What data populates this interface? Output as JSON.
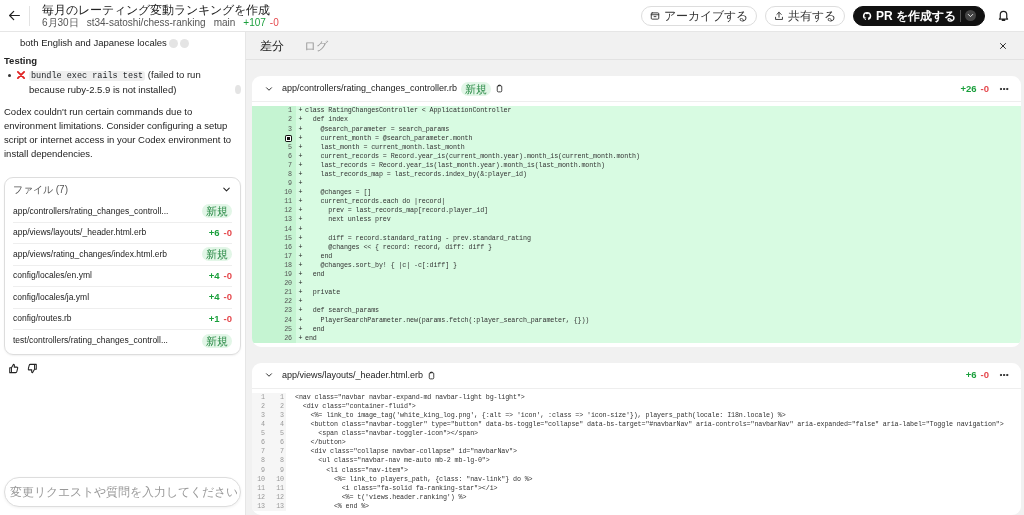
{
  "header": {
    "title": "毎月のレーティング変動ランキングを作成",
    "date": "6月30日",
    "repo": "st34-satoshi/chess-ranking",
    "branch": "main",
    "additions": "+107",
    "deletions": "-0"
  },
  "actions": [
    {
      "kind": "archive",
      "label": "アーカイブする"
    },
    {
      "kind": "share",
      "label": "共有する"
    },
    {
      "kind": "pr",
      "label": "PR を作成する"
    }
  ],
  "sidebar": {
    "summary_tail": "both English and Japanese locales",
    "testing_heading": "Testing",
    "tests": [
      {
        "passed": false,
        "command": "bundle exec rails test",
        "note": "(failed to run because ruby-2.5.9 is not installed)"
      }
    ],
    "note": "Codex couldn't run certain commands due to environment limitations. Consider configuring a setup script or internet access in your Codex environment to install dependencies.",
    "files": {
      "title": "ファイル (7)",
      "expanded": true,
      "items": [
        {
          "name": "app/controllers/rating_changes_controll...",
          "kind": "new",
          "badge": "新規"
        },
        {
          "name": "app/views/layouts/_header.html.erb",
          "kind": "diff",
          "additions": "+6",
          "deletions": "-0"
        },
        {
          "name": "app/views/rating_changes/index.html.erb",
          "kind": "new",
          "badge": "新規"
        },
        {
          "name": "config/locales/en.yml",
          "kind": "diff",
          "additions": "+4",
          "deletions": "-0"
        },
        {
          "name": "config/locales/ja.yml",
          "kind": "diff",
          "additions": "+4",
          "deletions": "-0"
        },
        {
          "name": "config/routes.rb",
          "kind": "diff",
          "additions": "+1",
          "deletions": "-0"
        },
        {
          "name": "test/controllers/rating_changes_controll...",
          "kind": "new",
          "badge": "新規"
        }
      ]
    },
    "input": {
      "placeholder": "変更リクエストや質問を入力してください"
    }
  },
  "tabs": [
    {
      "label": "差分",
      "selected": true
    },
    {
      "label": "ログ",
      "selected": false
    }
  ],
  "diffs": [
    {
      "path": "app/controllers/rating_changes_controller.rb",
      "badge": "新規",
      "expanded": true,
      "additions": "+26",
      "deletions": "-0",
      "lines": [
        {
          "kind": "added",
          "new": "1",
          "sign": "+",
          "text": "class RatingChangesController < ApplicationController"
        },
        {
          "kind": "added",
          "new": "2",
          "sign": "+",
          "text": "  def index"
        },
        {
          "kind": "added",
          "new": "3",
          "sign": "+",
          "text": "    @search_parameter = search_params"
        },
        {
          "kind": "added",
          "marker": true,
          "sign": "+",
          "text": "    current_month = @search_parameter.month"
        },
        {
          "kind": "added",
          "new": "5",
          "sign": "+",
          "text": "    last_month = current_month.last_month"
        },
        {
          "kind": "added",
          "new": "6",
          "sign": "+",
          "text": "    current_records = Record.year_is(current_month.year).month_is(current_month.month)"
        },
        {
          "kind": "added",
          "new": "7",
          "sign": "+",
          "text": "    last_records = Record.year_is(last_month.year).month_is(last_month.month)"
        },
        {
          "kind": "added",
          "new": "8",
          "sign": "+",
          "text": "    last_records_map = last_records.index_by(&:player_id)"
        },
        {
          "kind": "added",
          "new": "9",
          "sign": "+"
        },
        {
          "kind": "added",
          "new": "10",
          "sign": "+",
          "text": "    @changes = []"
        },
        {
          "kind": "added",
          "new": "11",
          "sign": "+",
          "text": "    current_records.each do |record|"
        },
        {
          "kind": "added",
          "new": "12",
          "sign": "+",
          "text": "      prev = last_records_map[record.player_id]"
        },
        {
          "kind": "added",
          "new": "13",
          "sign": "+",
          "text": "      next unless prev"
        },
        {
          "kind": "added",
          "new": "14",
          "sign": "+"
        },
        {
          "kind": "added",
          "new": "15",
          "sign": "+",
          "text": "      diff = record.standard_rating - prev.standard_rating"
        },
        {
          "kind": "added",
          "new": "16",
          "sign": "+",
          "text": "      @changes << { record: record, diff: diff }"
        },
        {
          "kind": "added",
          "new": "17",
          "sign": "+",
          "text": "    end"
        },
        {
          "kind": "added",
          "new": "18",
          "sign": "+",
          "text": "    @changes.sort_by! { |c| -c[:diff] }"
        },
        {
          "kind": "added",
          "new": "19",
          "sign": "+",
          "text": "  end"
        },
        {
          "kind": "added",
          "new": "20",
          "sign": "+"
        },
        {
          "kind": "added",
          "new": "21",
          "sign": "+",
          "text": "  private"
        },
        {
          "kind": "added",
          "new": "22",
          "sign": "+"
        },
        {
          "kind": "added",
          "new": "23",
          "sign": "+",
          "text": "  def search_params"
        },
        {
          "kind": "added",
          "new": "24",
          "sign": "+",
          "text": "    PlayerSearchParameter.new(params.fetch(:player_search_parameter, {}))"
        },
        {
          "kind": "added",
          "new": "25",
          "sign": "+",
          "text": "  end"
        },
        {
          "kind": "added",
          "new": "26",
          "sign": "+",
          "text": "end"
        }
      ]
    },
    {
      "path": "app/views/layouts/_header.html.erb",
      "expanded": true,
      "additions": "+6",
      "deletions": "-0",
      "lines": [
        {
          "kind": "context",
          "old": "1",
          "new": "1",
          "text": "<nav class=\"navbar navbar-expand-md navbar-light bg-light\">"
        },
        {
          "kind": "context",
          "old": "2",
          "new": "2",
          "text": "  <div class=\"container-fluid\">"
        },
        {
          "kind": "context",
          "old": "3",
          "new": "3",
          "text": "    <%= link_to image_tag('white_king_log.png', {:alt => 'icon', :class => 'icon-size'}), players_path(locale: I18n.locale) %>"
        },
        {
          "kind": "context",
          "old": "4",
          "new": "4",
          "text": "    <button class=\"navbar-toggler\" type=\"button\" data-bs-toggle=\"collapse\" data-bs-target=\"#navbarNav\" aria-controls=\"navbarNav\" aria-expanded=\"false\" aria-label=\"Toggle navigation\">"
        },
        {
          "kind": "context",
          "old": "5",
          "new": "5",
          "text": "      <span class=\"navbar-toggler-icon\"></span>"
        },
        {
          "kind": "context",
          "old": "6",
          "new": "6",
          "text": "    </button>"
        },
        {
          "kind": "context",
          "old": "7",
          "new": "7",
          "text": "    <div class=\"collapse navbar-collapse\" id=\"navbarNav\">"
        },
        {
          "kind": "context",
          "old": "8",
          "new": "8",
          "text": "      <ul class=\"navbar-nav me-auto mb-2 mb-lg-0\">"
        },
        {
          "kind": "context",
          "old": "9",
          "new": "9",
          "text": "        <li class=\"nav-item\">"
        },
        {
          "kind": "context",
          "old": "10",
          "new": "10",
          "text": "          <%= link_to players_path, {class: \"nav-link\"} do %>"
        },
        {
          "kind": "context",
          "old": "11",
          "new": "11",
          "text": "            <i class=\"fa-solid fa-ranking-star\"></i>"
        },
        {
          "kind": "context",
          "old": "12",
          "new": "12",
          "text": "            <%= t('views.header.ranking') %>"
        },
        {
          "kind": "context",
          "old": "13",
          "new": "13",
          "text": "          <% end %>"
        }
      ]
    }
  ]
}
